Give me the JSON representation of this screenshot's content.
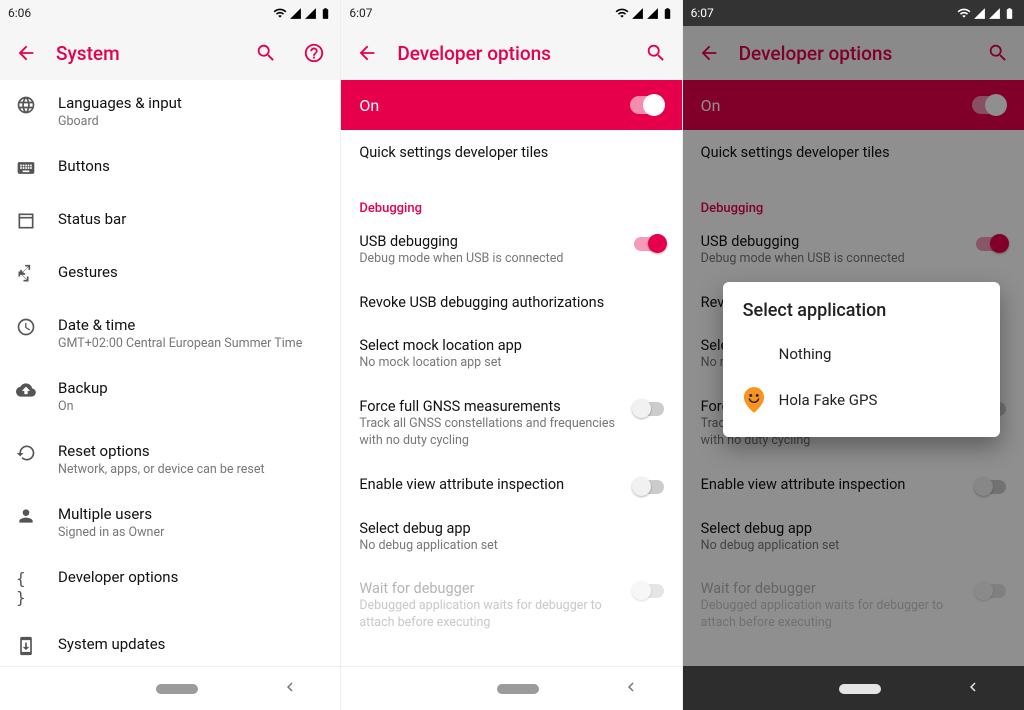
{
  "status": {
    "time1": "6:06",
    "time2": "6:07",
    "time3": "6:07"
  },
  "panel1": {
    "title": "System",
    "items": [
      {
        "label": "Languages & input",
        "sub": "Gboard"
      },
      {
        "label": "Buttons",
        "sub": ""
      },
      {
        "label": "Status bar",
        "sub": ""
      },
      {
        "label": "Gestures",
        "sub": ""
      },
      {
        "label": "Date & time",
        "sub": "GMT+02:00 Central European Summer Time"
      },
      {
        "label": "Backup",
        "sub": "On"
      },
      {
        "label": "Reset options",
        "sub": "Network, apps, or device can be reset"
      },
      {
        "label": "Multiple users",
        "sub": "Signed in as Owner"
      },
      {
        "label": "Developer options",
        "sub": ""
      },
      {
        "label": "System updates",
        "sub": ""
      }
    ]
  },
  "dev": {
    "title": "Developer options",
    "hero": "On",
    "quick": "Quick settings developer tiles",
    "section": "Debugging",
    "items": [
      {
        "p": "USB debugging",
        "s": "Debug mode when USB is connected"
      },
      {
        "p": "Revoke USB debugging authorizations",
        "s": ""
      },
      {
        "p": "Select mock location app",
        "s": "No mock location app set"
      },
      {
        "p": "Force full GNSS measurements",
        "s": "Track all GNSS constellations and frequencies with no duty cycling"
      },
      {
        "p": "Enable view attribute inspection",
        "s": ""
      },
      {
        "p": "Select debug app",
        "s": "No debug application set"
      },
      {
        "p": "Wait for debugger",
        "s": "Debugged application waits for debugger to attach before executing"
      }
    ]
  },
  "dialog": {
    "title": "Select application",
    "opts": [
      "Nothing",
      "Hola Fake GPS"
    ]
  },
  "colors": {
    "accent": "#e6004c"
  }
}
